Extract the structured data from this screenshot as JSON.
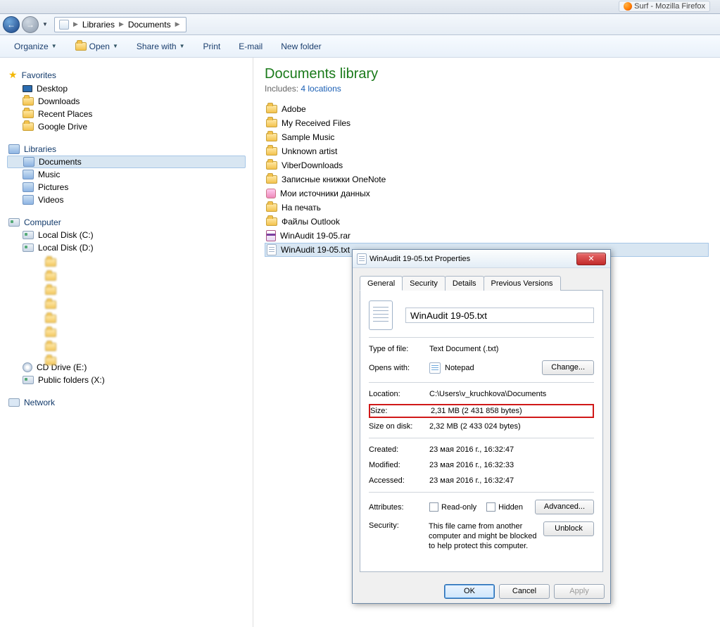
{
  "taskbar": {
    "browser_tab": "Surf - Mozilla Firefox"
  },
  "breadcrumb": {
    "root": "Libraries",
    "current": "Documents"
  },
  "toolbar": {
    "organize": "Organize",
    "open": "Open",
    "share": "Share with",
    "print": "Print",
    "email": "E-mail",
    "newfolder": "New folder"
  },
  "sidebar": {
    "favorites": "Favorites",
    "fav_items": {
      "desktop": "Desktop",
      "downloads": "Downloads",
      "recent": "Recent Places",
      "gdrive": "Google Drive"
    },
    "libraries": "Libraries",
    "lib_items": {
      "documents": "Documents",
      "music": "Music",
      "pictures": "Pictures",
      "videos": "Videos"
    },
    "computer": "Computer",
    "drives": {
      "c": "Local Disk (C:)",
      "d": "Local Disk (D:)",
      "cd": "CD Drive (E:)",
      "pub": "Public folders (X:)"
    },
    "network": "Network"
  },
  "library": {
    "title": "Documents library",
    "includes": "Includes:",
    "locations": "4 locations"
  },
  "files": {
    "adobe": "Adobe",
    "received": "My Received Files",
    "samplemusic": "Sample Music",
    "unknown": "Unknown artist",
    "viber": "ViberDownloads",
    "onenote": "Записные книжки OneNote",
    "datasrc": "Мои источники данных",
    "print": "На печать",
    "outlook": "Файлы Outlook",
    "rar": "WinAudit 19-05.rar",
    "txt": "WinAudit 19-05.txt"
  },
  "dialog": {
    "title": "WinAudit 19-05.txt Properties",
    "tabs": {
      "general": "General",
      "security": "Security",
      "details": "Details",
      "prev": "Previous Versions"
    },
    "filename": "WinAudit 19-05.txt",
    "type_lbl": "Type of file:",
    "type_val": "Text Document (.txt)",
    "opens_lbl": "Opens with:",
    "opens_val": "Notepad",
    "change_btn": "Change...",
    "loc_lbl": "Location:",
    "loc_val": "C:\\Users\\v_kruchkova\\Documents",
    "size_lbl": "Size:",
    "size_val": "2,31 MB (2 431 858 bytes)",
    "disk_lbl": "Size on disk:",
    "disk_val": "2,32 MB (2 433 024 bytes)",
    "created_lbl": "Created:",
    "created_val": "23 мая 2016 г., 16:32:47",
    "modified_lbl": "Modified:",
    "modified_val": "23 мая 2016 г., 16:32:33",
    "accessed_lbl": "Accessed:",
    "accessed_val": "23 мая 2016 г., 16:32:47",
    "attr_lbl": "Attributes:",
    "readonly": "Read-only",
    "hidden": "Hidden",
    "advanced": "Advanced...",
    "sec_lbl": "Security:",
    "sec_text": "This file came from another computer and might be blocked to help protect this computer.",
    "unblock": "Unblock",
    "ok": "OK",
    "cancel": "Cancel",
    "apply": "Apply"
  }
}
